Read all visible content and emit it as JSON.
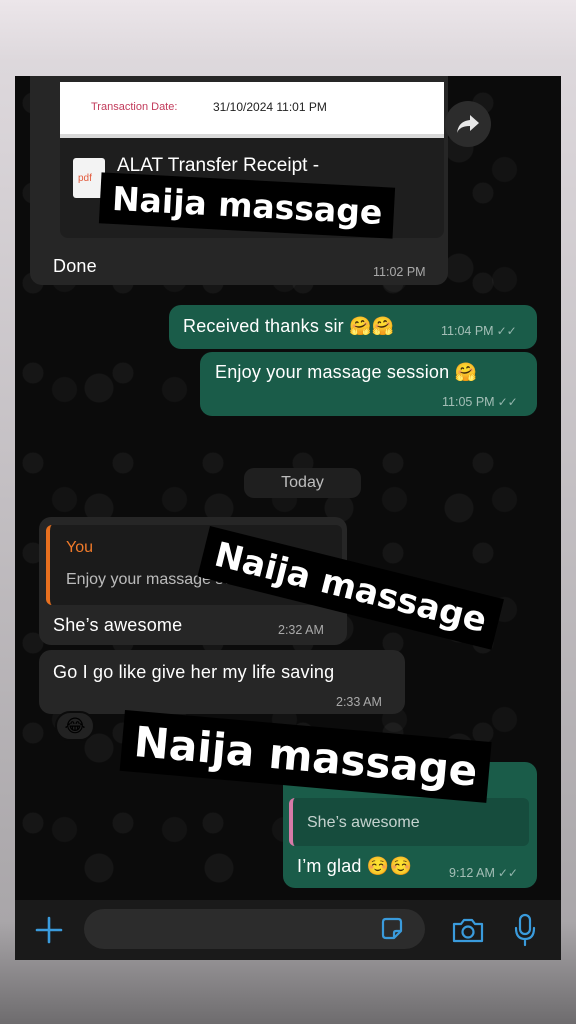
{
  "messages": {
    "receipt": {
      "transaction_label": "Transaction Date:",
      "transaction_value": "31/10/2024 11:01 PM",
      "file_icon": "pdf",
      "doc_title": "ALAT Transfer Receipt -",
      "text": "Done",
      "time": "11:02 PM"
    },
    "out1": {
      "text": "Received thanks sir 🤗🤗",
      "time": "11:04 PM"
    },
    "out2": {
      "text": "Enjoy your massage session 🤗",
      "time": "11:05 PM"
    },
    "date_divider": "Today",
    "in1": {
      "quote_author": "You",
      "quote_text": "Enjoy your massage session 🤗",
      "text": "She’s awesome",
      "time": "2:32 AM"
    },
    "in2": {
      "text": "Go I go like give her my life saving",
      "time": "2:33 AM",
      "reaction": "😂"
    },
    "out3": {
      "quote_text": "She’s awesome",
      "text": "I’m glad ☺️☺️",
      "time": "9:12 AM"
    }
  },
  "overlay": {
    "sticker1": "Naija massage",
    "sticker2": "Naija massage",
    "sticker3": "Naija massage"
  },
  "icons": {
    "forward": "forward-arrow-icon",
    "plus": "plus-icon",
    "sticker": "sticker-icon",
    "camera": "camera-icon",
    "mic": "microphone-icon"
  },
  "colors": {
    "incoming_bubble": "#262626",
    "outgoing_bubble": "#1a5c49",
    "accent_blue": "#3a9bdc",
    "quote_orange": "#f07a2a"
  }
}
